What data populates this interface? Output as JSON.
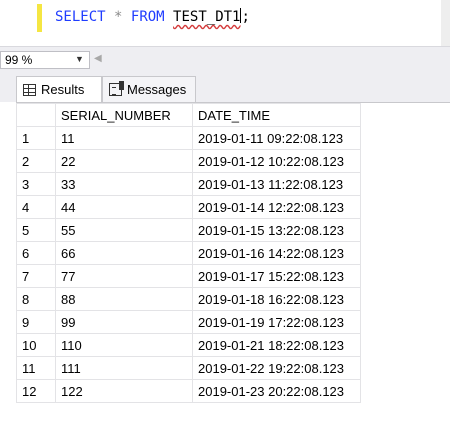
{
  "editor": {
    "kw_select": "SELECT",
    "op_star": "*",
    "kw_from": "FROM",
    "table_name": "TEST_DT1",
    "terminator": ";"
  },
  "zoom": {
    "value": "99 %"
  },
  "tabs": [
    {
      "label": "Results",
      "icon": "grid-icon"
    },
    {
      "label": "Messages",
      "icon": "messages-icon"
    }
  ],
  "results": {
    "columns": [
      "",
      "SERIAL_NUMBER",
      "DATE_TIME"
    ],
    "rows": [
      {
        "n": "1",
        "serial": "11",
        "date": "2019-01-11 09:22:08.123"
      },
      {
        "n": "2",
        "serial": "22",
        "date": "2019-01-12 10:22:08.123"
      },
      {
        "n": "3",
        "serial": "33",
        "date": "2019-01-13 11:22:08.123"
      },
      {
        "n": "4",
        "serial": "44",
        "date": "2019-01-14 12:22:08.123"
      },
      {
        "n": "5",
        "serial": "55",
        "date": "2019-01-15 13:22:08.123"
      },
      {
        "n": "6",
        "serial": "66",
        "date": "2019-01-16 14:22:08.123"
      },
      {
        "n": "7",
        "serial": "77",
        "date": "2019-01-17 15:22:08.123"
      },
      {
        "n": "8",
        "serial": "88",
        "date": "2019-01-18 16:22:08.123"
      },
      {
        "n": "9",
        "serial": "99",
        "date": "2019-01-19 17:22:08.123"
      },
      {
        "n": "10",
        "serial": "110",
        "date": "2019-01-21 18:22:08.123"
      },
      {
        "n": "11",
        "serial": "111",
        "date": "2019-01-22 19:22:08.123"
      },
      {
        "n": "12",
        "serial": "122",
        "date": "2019-01-23 20:22:08.123"
      }
    ]
  },
  "colors": {
    "keyword": "#1f3cff",
    "editor_margin_mark": "#f5e642",
    "chrome_bg": "#eeeef2"
  }
}
